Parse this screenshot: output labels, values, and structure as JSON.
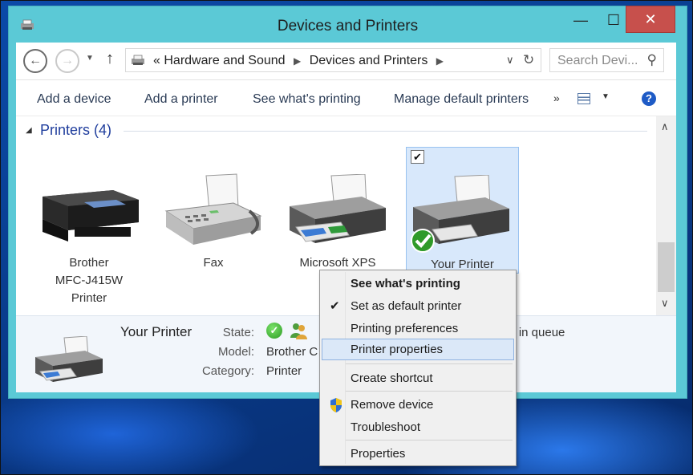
{
  "window": {
    "title": "Devices and Printers",
    "minimize_glyph": "—",
    "maximize_glyph": "☐",
    "close_glyph": "✕"
  },
  "address": {
    "prefix": "«",
    "crumbs": [
      "Hardware and Sound",
      "Devices and Printers"
    ],
    "search_placeholder": "Search Devi..."
  },
  "commands": {
    "add_device": "Add a device",
    "add_printer": "Add a printer",
    "see_printing": "See what's printing",
    "manage_default": "Manage default printers",
    "more": "»"
  },
  "group": {
    "title": "Printers (4)"
  },
  "devices": [
    {
      "label": "Brother MFC-J415W Printer",
      "icon": "multifunction-printer-icon"
    },
    {
      "label": "Fax",
      "icon": "fax-icon"
    },
    {
      "label": "Microsoft XPS Docu",
      "icon": "printer-icon"
    },
    {
      "label": "Your Printer",
      "icon": "default-printer-icon",
      "selected": true,
      "is_default": true
    }
  ],
  "details": {
    "name": "Your Printer",
    "state_label": "State:",
    "model_label": "Model:",
    "model_value": "Brother C",
    "category_label": "Category:",
    "category_value": "Printer",
    "queue_text": "t(s) in queue"
  },
  "context_menu": {
    "items": [
      {
        "label": "See what's printing",
        "bold": true
      },
      {
        "label": "Set as default printer",
        "checked": true
      },
      {
        "label": "Printing preferences"
      },
      {
        "label": "Printer properties",
        "hover": true
      },
      {
        "label": "Create shortcut"
      },
      {
        "label": "Remove device",
        "icon": "shield-icon"
      },
      {
        "label": "Troubleshoot"
      },
      {
        "label": "Properties"
      }
    ]
  },
  "colors": {
    "frame": "#5bc9d6",
    "close_button": "#c7504c",
    "group_title": "#1e3c9c",
    "selection": "#d8e8fb",
    "menu_hover": "#dbe8f8"
  }
}
